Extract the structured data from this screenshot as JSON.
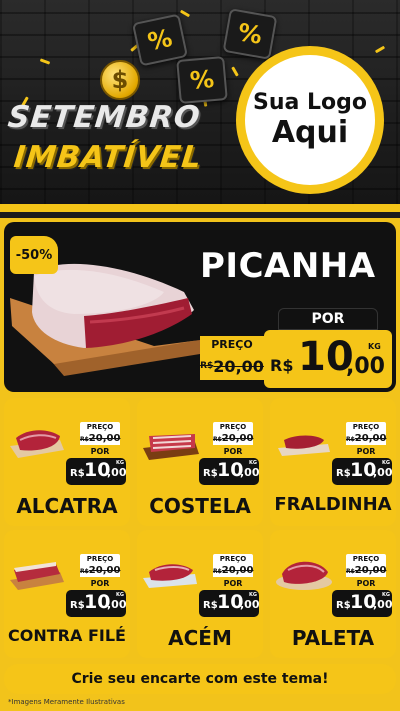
{
  "header": {
    "coin_symbol": "$",
    "percent_symbol": "%",
    "title_line1": "SETEMBRO",
    "title_line2": "IMBATÍVEL",
    "logo_line1": "Sua Logo",
    "logo_line2": "Aqui"
  },
  "featured": {
    "badge": "-50%",
    "name": "PICANHA",
    "preco_label": "PREÇO",
    "old_price": "R$ 20,00",
    "old_prefix": "R$",
    "old_value": "20,00",
    "por_label": "POR",
    "currency": "R$",
    "price_int": "10",
    "price_dec": ",00",
    "unit": "KG"
  },
  "products": [
    {
      "name": "ALCATRA",
      "preco_label": "PREÇO",
      "old_prefix": "R$",
      "old_value": "20,00",
      "por_label": "POR",
      "currency": "R$",
      "price_int": "10",
      "price_dec": ",00",
      "unit": "KG"
    },
    {
      "name": "COSTELA",
      "preco_label": "PREÇO",
      "old_prefix": "R$",
      "old_value": "20,00",
      "por_label": "POR",
      "currency": "R$",
      "price_int": "10",
      "price_dec": ",00",
      "unit": "KG"
    },
    {
      "name": "FRALDINHA",
      "preco_label": "PREÇO",
      "old_prefix": "R$",
      "old_value": "20,00",
      "por_label": "POR",
      "currency": "R$",
      "price_int": "10",
      "price_dec": ",00",
      "unit": "KG"
    },
    {
      "name": "CONTRA FILÉ",
      "preco_label": "PREÇO",
      "old_prefix": "R$",
      "old_value": "20,00",
      "por_label": "POR",
      "currency": "R$",
      "price_int": "10",
      "price_dec": ",00",
      "unit": "KG"
    },
    {
      "name": "ACÉM",
      "preco_label": "PREÇO",
      "old_prefix": "R$",
      "old_value": "20,00",
      "por_label": "POR",
      "currency": "R$",
      "price_int": "10",
      "price_dec": ",00",
      "unit": "KG"
    },
    {
      "name": "PALETA",
      "preco_label": "PREÇO",
      "old_prefix": "R$",
      "old_value": "20,00",
      "por_label": "POR",
      "currency": "R$",
      "price_int": "10",
      "price_dec": ",00",
      "unit": "KG"
    }
  ],
  "cta": "Crie seu encarte com este tema!",
  "footnote": "*Imagens Meramente Ilustrativas",
  "colors": {
    "accent_yellow": "#f5c518",
    "background_yellow": "#f2c31b",
    "dark": "#111111",
    "meat_red": "#b3233a"
  },
  "icons": [
    "dollar-coin-icon",
    "percent-icon",
    "meat-image"
  ]
}
